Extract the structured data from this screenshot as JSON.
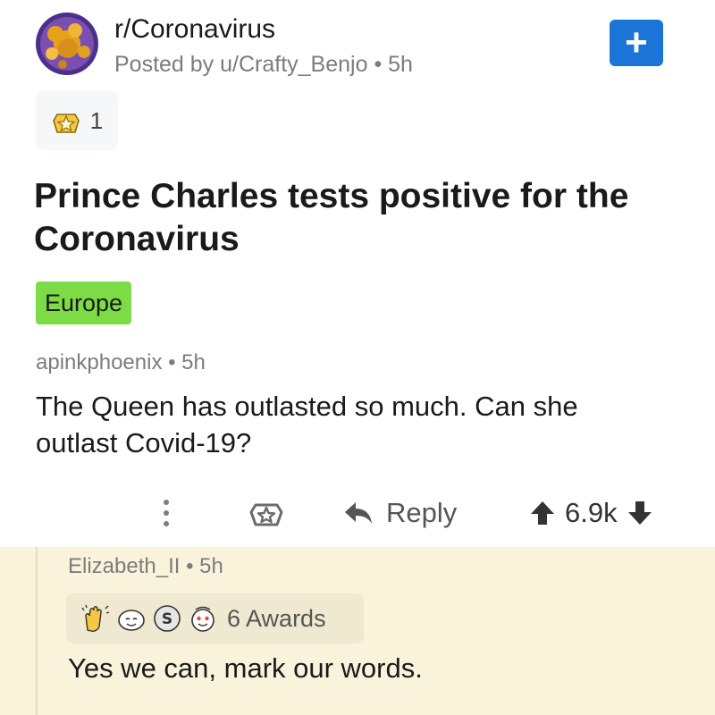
{
  "post": {
    "subreddit": "r/Coronavirus",
    "posted_by": "Posted by u/Crafty_Benjo • 5h",
    "join_label": "+",
    "award_count": "1",
    "title": "Prince Charles tests positive for the Coronavirus",
    "flair": "Europe"
  },
  "comment1": {
    "meta": "apinkphoenix • 5h",
    "body": "The Queen has outlasted so much. Can she outlast Covid-19?",
    "reply_label": "Reply",
    "score": "6.9k"
  },
  "comment2": {
    "meta": "Elizabeth_II • 5h",
    "awards_label": "6 Awards",
    "body": "Yes we can, mark our words."
  },
  "colors": {
    "accent": "#1b74d8",
    "flair_bg": "#7ddb46",
    "reply_bg": "#f9f3dc"
  }
}
